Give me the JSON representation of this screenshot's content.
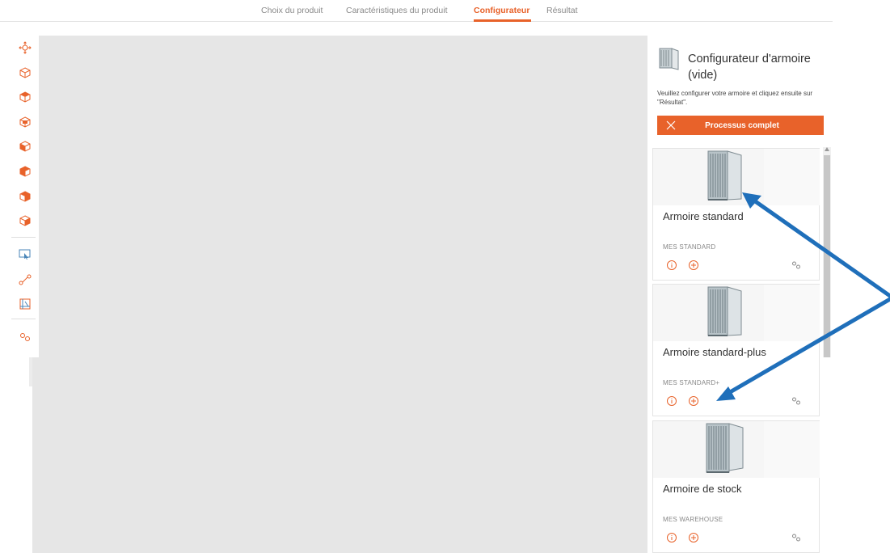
{
  "tabs": [
    {
      "label": "Choix du produit",
      "active": false
    },
    {
      "label": "Caractéristiques du produit",
      "active": false
    },
    {
      "label": "Configurateur",
      "active": true
    },
    {
      "label": "Résultat",
      "active": false
    }
  ],
  "toolbar": {
    "icons": [
      "move-icon",
      "cube-outline-icon",
      "cube-top-icon",
      "cube-side-icon",
      "cube-front-icon",
      "cube-left-icon",
      "cube-right-icon",
      "cube-bottom-icon",
      "select-area-icon",
      "connect-icon",
      "layout-icon",
      "settings-gears-icon"
    ]
  },
  "panel": {
    "title": "Configurateur d'armoire (vide)",
    "description": "Veuillez configurer votre armoire et cliquez ensuite sur \"Résultat\".",
    "process_button": "Processus complet",
    "cards": [
      {
        "name": "Armoire standard",
        "code": "MES STANDARD"
      },
      {
        "name": "Armoire standard-plus",
        "code": "MES STANDARD+"
      },
      {
        "name": "Armoire de stock",
        "code": "MES WAREHOUSE"
      }
    ]
  },
  "colors": {
    "accent": "#e8622a",
    "annotation_arrow": "#1f6fba",
    "canvas": "#e6e6e6"
  }
}
